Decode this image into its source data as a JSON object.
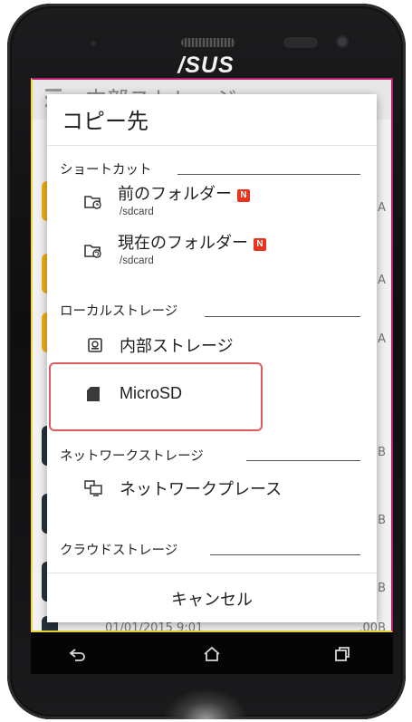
{
  "device": {
    "brand": "/SUS"
  },
  "background_app": {
    "title": "内部ストレージ",
    "rows": [
      {
        "date": "",
        "tail": "A",
        "color": "#f1b11c"
      },
      {
        "date": "",
        "tail": "A",
        "color": "#f1b11c"
      },
      {
        "date": "",
        "tail": "A",
        "color": "#f1b11c"
      },
      {
        "date": "",
        "tail": "B",
        "color": "#26323a"
      },
      {
        "date": "",
        "tail": "B",
        "color": "#26323a"
      },
      {
        "date": "",
        "tail": "B",
        "color": "#26323a"
      },
      {
        "date": "01/01/2015 9:01",
        "tail": ".00B",
        "color": "#26323a"
      }
    ]
  },
  "dialog": {
    "title": "コピー先",
    "sections": {
      "shortcuts": {
        "label": "ショートカット",
        "items": [
          {
            "label": "前のフォルダー",
            "path": "/sdcard",
            "badge": "N",
            "icon": "folder-history-icon"
          },
          {
            "label": "現在のフォルダー",
            "path": "/sdcard",
            "badge": "N",
            "icon": "folder-refresh-icon"
          }
        ]
      },
      "local": {
        "label": "ローカルストレージ",
        "items": [
          {
            "label": "内部ストレージ",
            "icon": "internal-storage-icon"
          },
          {
            "label": "MicroSD",
            "icon": "sd-card-icon"
          }
        ]
      },
      "network": {
        "label": "ネットワークストレージ",
        "items": [
          {
            "label": "ネットワークプレース",
            "icon": "network-place-icon"
          }
        ]
      },
      "cloud": {
        "label": "クラウドストレージ"
      }
    },
    "cancel_label": "キャンセル"
  },
  "navbar": {
    "back": "back-icon",
    "home": "home-icon",
    "recents": "recents-icon"
  },
  "colors": {
    "badge": "#e8341e",
    "highlight": "#e05a5a",
    "folder_yellow": "#f1b11c"
  }
}
